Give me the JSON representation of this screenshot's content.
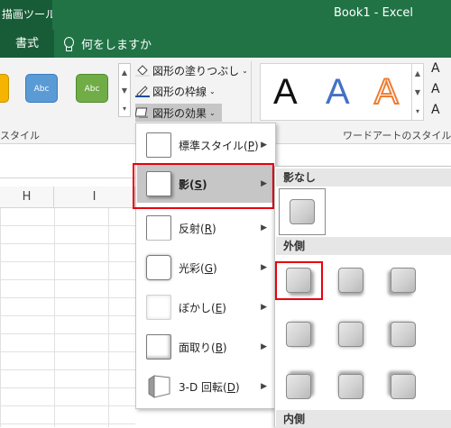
{
  "title_bar": {
    "contextual_tab": "描画ツール",
    "window_title": "Book1 - Excel"
  },
  "tabs": {
    "active": "書式",
    "tell_me": "何をしますか"
  },
  "ribbon": {
    "shape_styles": [
      "Abc",
      "Abc"
    ],
    "shape_style_colors": [
      "#f5b400",
      "#5b9bd5",
      "#70ad47"
    ],
    "shape_fill": "図形の塗りつぶし",
    "shape_outline": "図形の枠線",
    "shape_effects": "図形の効果",
    "group_style_label": "スタイル",
    "wordart_label": "ワードアートのスタイル",
    "wordart_letters": [
      "A",
      "A",
      "A"
    ],
    "text_cmd_letters": [
      "A",
      "A",
      "A"
    ]
  },
  "columns": [
    "H",
    "I"
  ],
  "effects_menu": [
    {
      "label": "標準スタイル(",
      "key": "P",
      "suffix": ")"
    },
    {
      "label": "影(",
      "key": "S",
      "suffix": ")"
    },
    {
      "label": "反射(",
      "key": "R",
      "suffix": ")"
    },
    {
      "label": "光彩(",
      "key": "G",
      "suffix": ")"
    },
    {
      "label": "ぼかし(",
      "key": "E",
      "suffix": ")"
    },
    {
      "label": "面取り(",
      "key": "B",
      "suffix": ")"
    },
    {
      "label": "3-D 回転(",
      "key": "D",
      "suffix": ")"
    }
  ],
  "shadow_submenu": {
    "no_shadow": "影なし",
    "outer": "外側",
    "inner": "内側"
  },
  "colors": {
    "excel_green": "#217346",
    "dark_green": "#185c37",
    "highlight_red": "#e8000e"
  }
}
